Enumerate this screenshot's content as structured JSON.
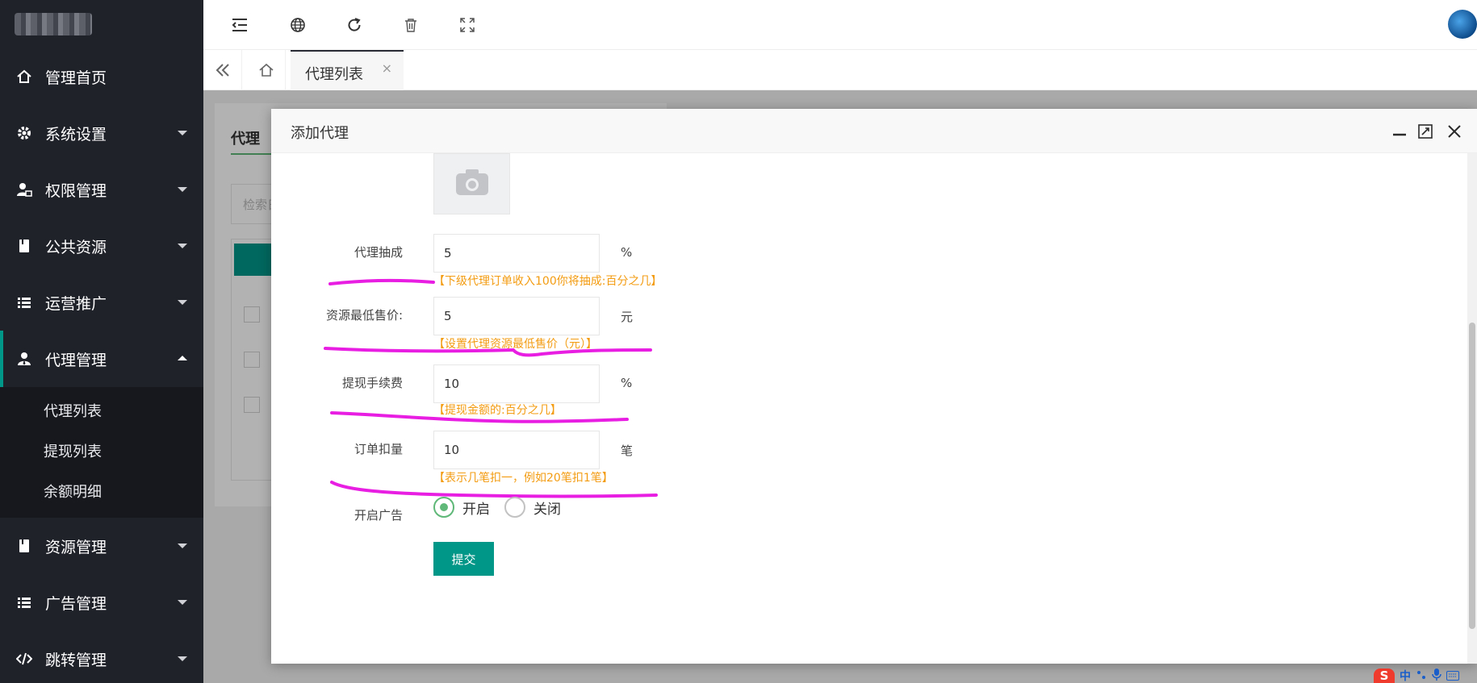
{
  "sidebar": {
    "items": [
      {
        "label": "管理首页"
      },
      {
        "label": "系统设置"
      },
      {
        "label": "权限管理"
      },
      {
        "label": "公共资源"
      },
      {
        "label": "运营推广"
      },
      {
        "label": "代理管理"
      },
      {
        "label": "资源管理"
      },
      {
        "label": "广告管理"
      },
      {
        "label": "跳转管理"
      }
    ],
    "sub_items": [
      {
        "label": "代理列表"
      },
      {
        "label": "提现列表"
      },
      {
        "label": "余额明细"
      }
    ]
  },
  "tabs": {
    "active_label": "代理列表",
    "close_glyph": "×"
  },
  "background": {
    "card_tab": "代理",
    "search_placeholder": "检索日"
  },
  "modal": {
    "title": "添加代理",
    "fields": [
      {
        "label": "代理抽成",
        "value": "5",
        "unit": "%",
        "hint": "【下级代理订单收入100你将抽成:百分之几】"
      },
      {
        "label": "资源最低售价:",
        "value": "5",
        "unit": "元",
        "hint": "【设置代理资源最低售价（元）】"
      },
      {
        "label": "提现手续费",
        "value": "10",
        "unit": "%",
        "hint": "【提现金额的:百分之几】"
      },
      {
        "label": "订单扣量",
        "value": "10",
        "unit": "笔",
        "hint": "【表示几笔扣一，例如20笔扣1笔】"
      }
    ],
    "ad_label": "开启广告",
    "ad_options": [
      {
        "label": "开启",
        "checked": true
      },
      {
        "label": "关闭",
        "checked": false
      }
    ],
    "submit_label": "提交"
  },
  "tray": {
    "s_icon": "S",
    "lang": "中"
  },
  "colors": {
    "sidebar_bg": "#20222a",
    "accent": "#009688",
    "hint": "#f39c12",
    "scribble": "#e81ee3"
  }
}
